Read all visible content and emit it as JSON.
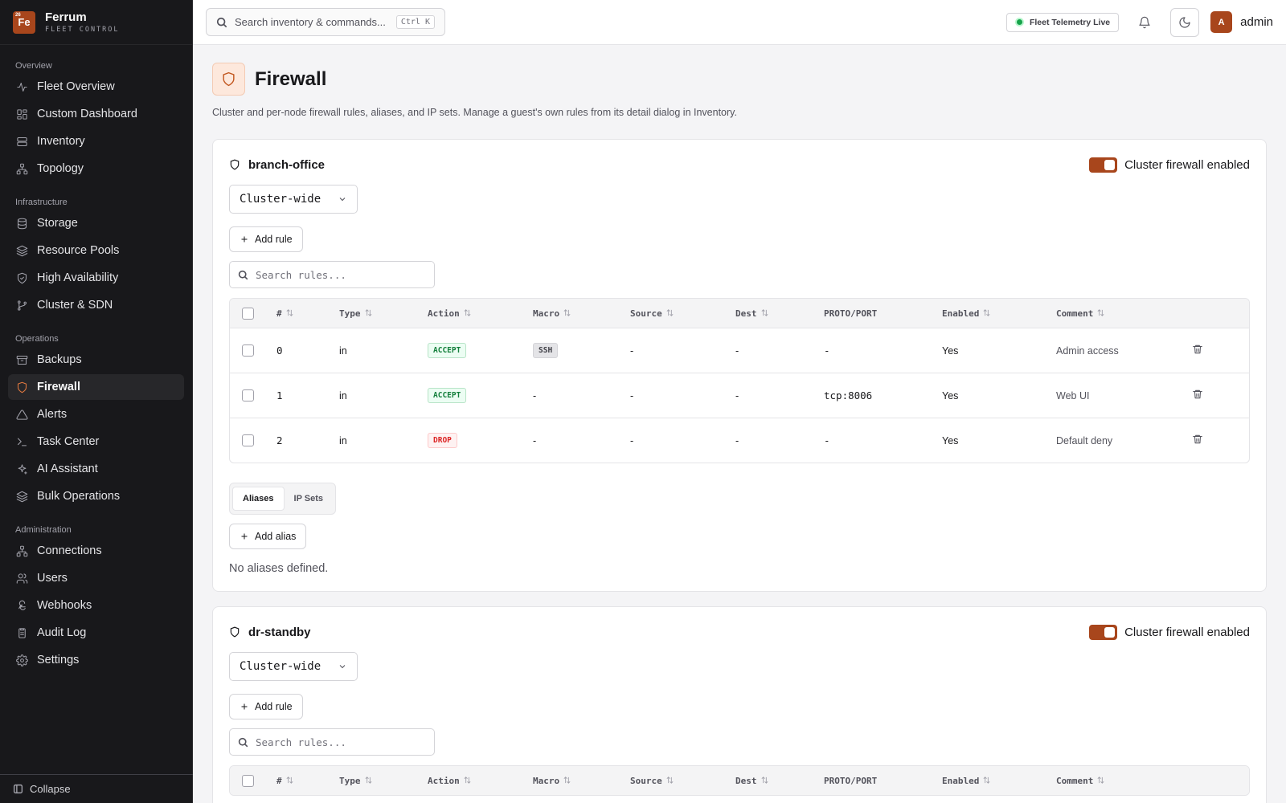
{
  "brand": {
    "name": "Ferrum",
    "subtitle": "FLEET CONTROL",
    "logo": "Fe",
    "logo_super": "26"
  },
  "search": {
    "placeholder": "Search inventory & commands...",
    "shortcut": "Ctrl K"
  },
  "topbar": {
    "telemetry": "Fleet Telemetry Live",
    "avatar_letter": "A",
    "username": "admin"
  },
  "sidebar": {
    "sections": [
      {
        "heading": "Overview",
        "items": [
          {
            "label": "Fleet Overview",
            "icon": "activity-icon"
          },
          {
            "label": "Custom Dashboard",
            "icon": "grid-icon"
          },
          {
            "label": "Inventory",
            "icon": "server-icon"
          },
          {
            "label": "Topology",
            "icon": "network-icon"
          }
        ]
      },
      {
        "heading": "Infrastructure",
        "items": [
          {
            "label": "Storage",
            "icon": "database-icon"
          },
          {
            "label": "Resource Pools",
            "icon": "layers-icon"
          },
          {
            "label": "High Availability",
            "icon": "shield-check-icon"
          },
          {
            "label": "Cluster & SDN",
            "icon": "git-branch-icon"
          }
        ]
      },
      {
        "heading": "Operations",
        "items": [
          {
            "label": "Backups",
            "icon": "archive-icon"
          },
          {
            "label": "Firewall",
            "icon": "shield-icon",
            "active": true
          },
          {
            "label": "Alerts",
            "icon": "alert-triangle-icon"
          },
          {
            "label": "Task Center",
            "icon": "terminal-icon"
          },
          {
            "label": "AI Assistant",
            "icon": "sparkles-icon"
          },
          {
            "label": "Bulk Operations",
            "icon": "layers-icon"
          }
        ]
      },
      {
        "heading": "Administration",
        "items": [
          {
            "label": "Connections",
            "icon": "network-icon"
          },
          {
            "label": "Users",
            "icon": "users-icon"
          },
          {
            "label": "Webhooks",
            "icon": "webhook-icon"
          },
          {
            "label": "Audit Log",
            "icon": "clipboard-icon"
          },
          {
            "label": "Settings",
            "icon": "gear-icon"
          }
        ]
      }
    ],
    "collapse_label": "Collapse"
  },
  "page": {
    "title": "Firewall",
    "description": "Cluster and per-node firewall rules, aliases, and IP sets. Manage a guest's own rules from its detail dialog in Inventory."
  },
  "columns": [
    "#",
    "Type",
    "Action",
    "Macro",
    "Source",
    "Dest",
    "PROTO/PORT",
    "Enabled",
    "Comment"
  ],
  "clusters": [
    {
      "name": "branch-office",
      "toggle_label": "Cluster firewall enabled",
      "toggle_on": true,
      "scope": "Cluster-wide",
      "add_rule_label": "Add rule",
      "rule_search_placeholder": "Search rules...",
      "rules": [
        {
          "num": "0",
          "type": "in",
          "action": "ACCEPT",
          "macro": "SSH",
          "source": "-",
          "dest": "-",
          "proto": "-",
          "enabled": "Yes",
          "comment": "Admin access"
        },
        {
          "num": "1",
          "type": "in",
          "action": "ACCEPT",
          "macro": "-",
          "source": "-",
          "dest": "-",
          "proto": "tcp:8006",
          "enabled": "Yes",
          "comment": "Web UI"
        },
        {
          "num": "2",
          "type": "in",
          "action": "DROP",
          "macro": "-",
          "source": "-",
          "dest": "-",
          "proto": "-",
          "enabled": "Yes",
          "comment": "Default deny"
        }
      ],
      "tabs": [
        "Aliases",
        "IP Sets"
      ],
      "active_tab": "Aliases",
      "add_alias_label": "Add alias",
      "empty_text": "No aliases defined."
    },
    {
      "name": "dr-standby",
      "toggle_label": "Cluster firewall enabled",
      "toggle_on": true,
      "scope": "Cluster-wide",
      "add_rule_label": "Add rule",
      "rule_search_placeholder": "Search rules...",
      "rules": []
    }
  ],
  "colors": {
    "accent": "#a8461c",
    "sidebar_bg": "#18181b",
    "accept": "#15803d",
    "drop": "#dc2626"
  }
}
